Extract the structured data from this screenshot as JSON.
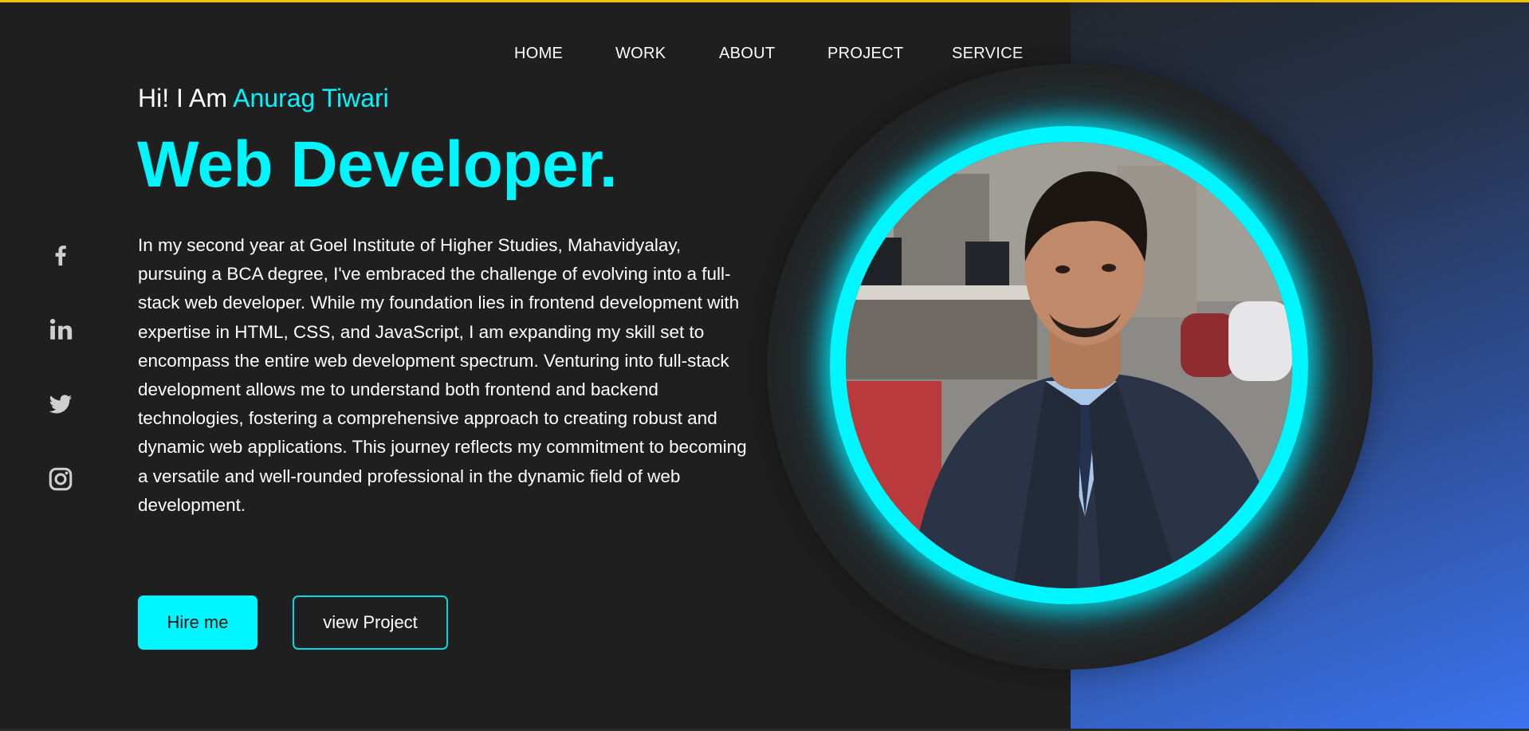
{
  "nav": {
    "items": [
      {
        "label": "HOME"
      },
      {
        "label": "WORK"
      },
      {
        "label": "ABOUT"
      },
      {
        "label": "PROJECT"
      },
      {
        "label": "SERVICE"
      }
    ]
  },
  "hero": {
    "greeting_prefix": "Hi! I Am ",
    "name": "Anurag Tiwari",
    "headline": "Web Developer.",
    "bio": "In my second year at Goel Institute of Higher Studies, Mahavidyalay, pursuing a BCA degree, I've embraced the challenge of evolving into a full-stack web developer. While my foundation lies in frontend development with expertise in HTML, CSS, and JavaScript, I am expanding my skill set to encompass the entire web development spectrum. Venturing into full-stack development allows me to understand both frontend and backend technologies, fostering a comprehensive approach to creating robust and dynamic web applications. This journey reflects my commitment to becoming a versatile and well-rounded professional in the dynamic field of web development.",
    "hire_button": "Hire me",
    "project_button": "view Project"
  },
  "social": [
    {
      "icon": "facebook-icon"
    },
    {
      "icon": "linkedin-icon"
    },
    {
      "icon": "twitter-icon"
    },
    {
      "icon": "instagram-icon"
    }
  ],
  "colors": {
    "accent": "#00f6ff",
    "background": "#1f1f1f",
    "top_bar": "#f2c200",
    "gradient_end": "#3b74f0"
  }
}
